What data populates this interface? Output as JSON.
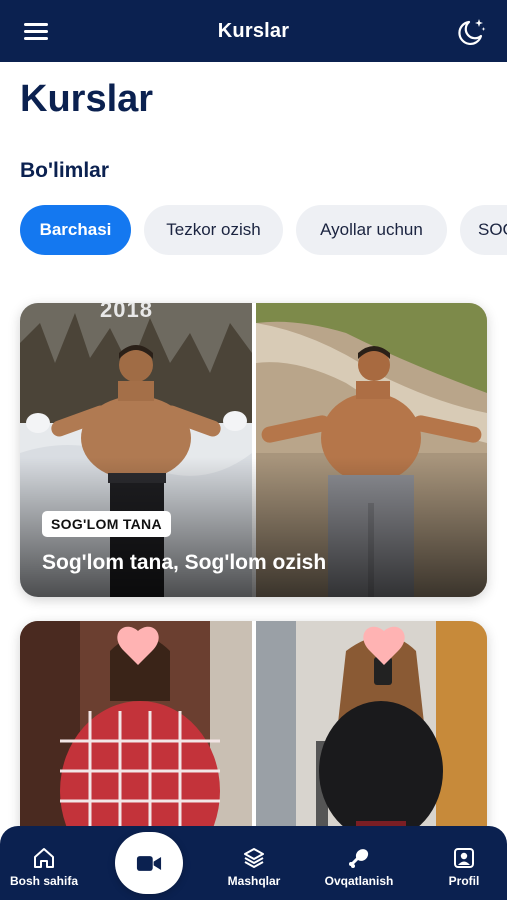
{
  "header": {
    "title": "Kurslar",
    "menu_icon": "hamburger-menu-icon",
    "theme_icon": "moon-stars-icon"
  },
  "page": {
    "title": "Kurslar",
    "section_title": "Bo'limlar"
  },
  "categories": [
    {
      "label": "Barchasi",
      "active": true
    },
    {
      "label": "Tezkor ozish",
      "active": false
    },
    {
      "label": "Ayollar uchun",
      "active": false
    },
    {
      "label": "SOG'LOM TANA",
      "active": false
    }
  ],
  "courses": [
    {
      "badge": "SOG'LOM TANA",
      "title": "Sog'lom tana, Sog'lom ozish",
      "image_caption": "2018"
    },
    {
      "badge": "",
      "title": ""
    }
  ],
  "bottom_nav": {
    "home": "Bosh sahifa",
    "workouts": "Mashqlar",
    "nutrition": "Ovqatlanish",
    "profile": "Profil"
  },
  "colors": {
    "primary": "#0b2150",
    "accent": "#1478f0",
    "chip_bg": "#eef0f4"
  }
}
